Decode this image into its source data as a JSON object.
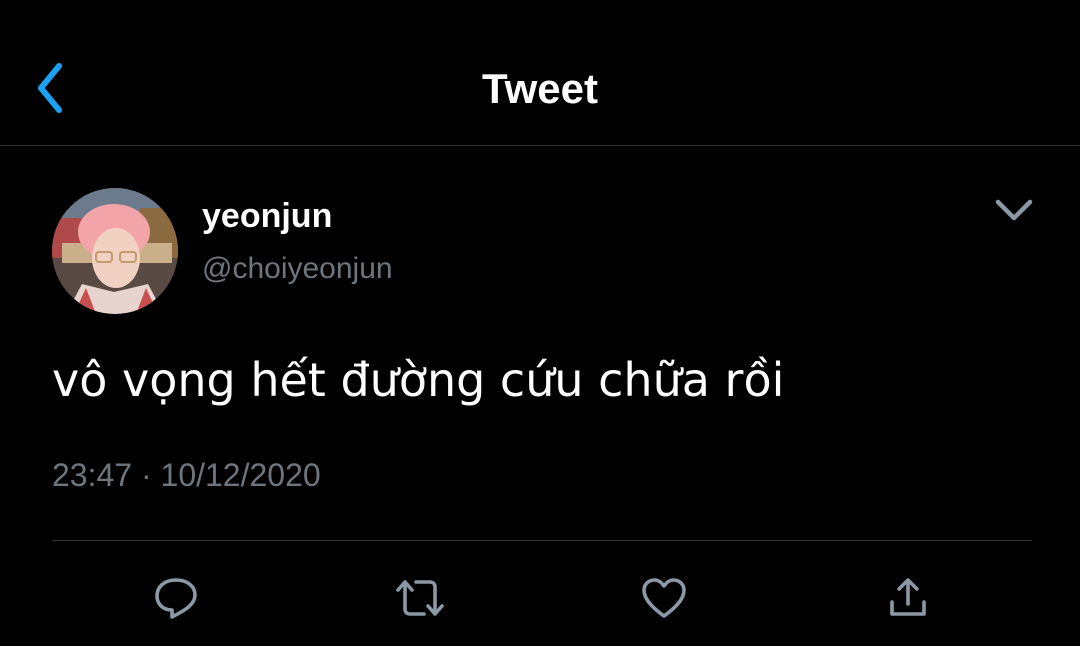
{
  "header": {
    "back_icon": "chevron-left-icon",
    "title": "Tweet"
  },
  "author": {
    "display_name": "yeonjun",
    "handle": "@choiyeonjun",
    "more_icon": "chevron-down-icon"
  },
  "tweet": {
    "text": "vô vọng hết đường cứu chữa rồi",
    "time": "23:47",
    "separator": "·",
    "date": "10/12/2020"
  },
  "actions": [
    {
      "name": "reply",
      "icon": "reply-icon"
    },
    {
      "name": "retweet",
      "icon": "retweet-icon"
    },
    {
      "name": "like",
      "icon": "heart-icon"
    },
    {
      "name": "share",
      "icon": "share-icon"
    }
  ],
  "colors": {
    "background": "#000000",
    "accent": "#1da1f2",
    "text_primary": "#ffffff",
    "text_secondary": "#6e767d",
    "divider": "#2f3336",
    "icon": "#8b98a5"
  }
}
